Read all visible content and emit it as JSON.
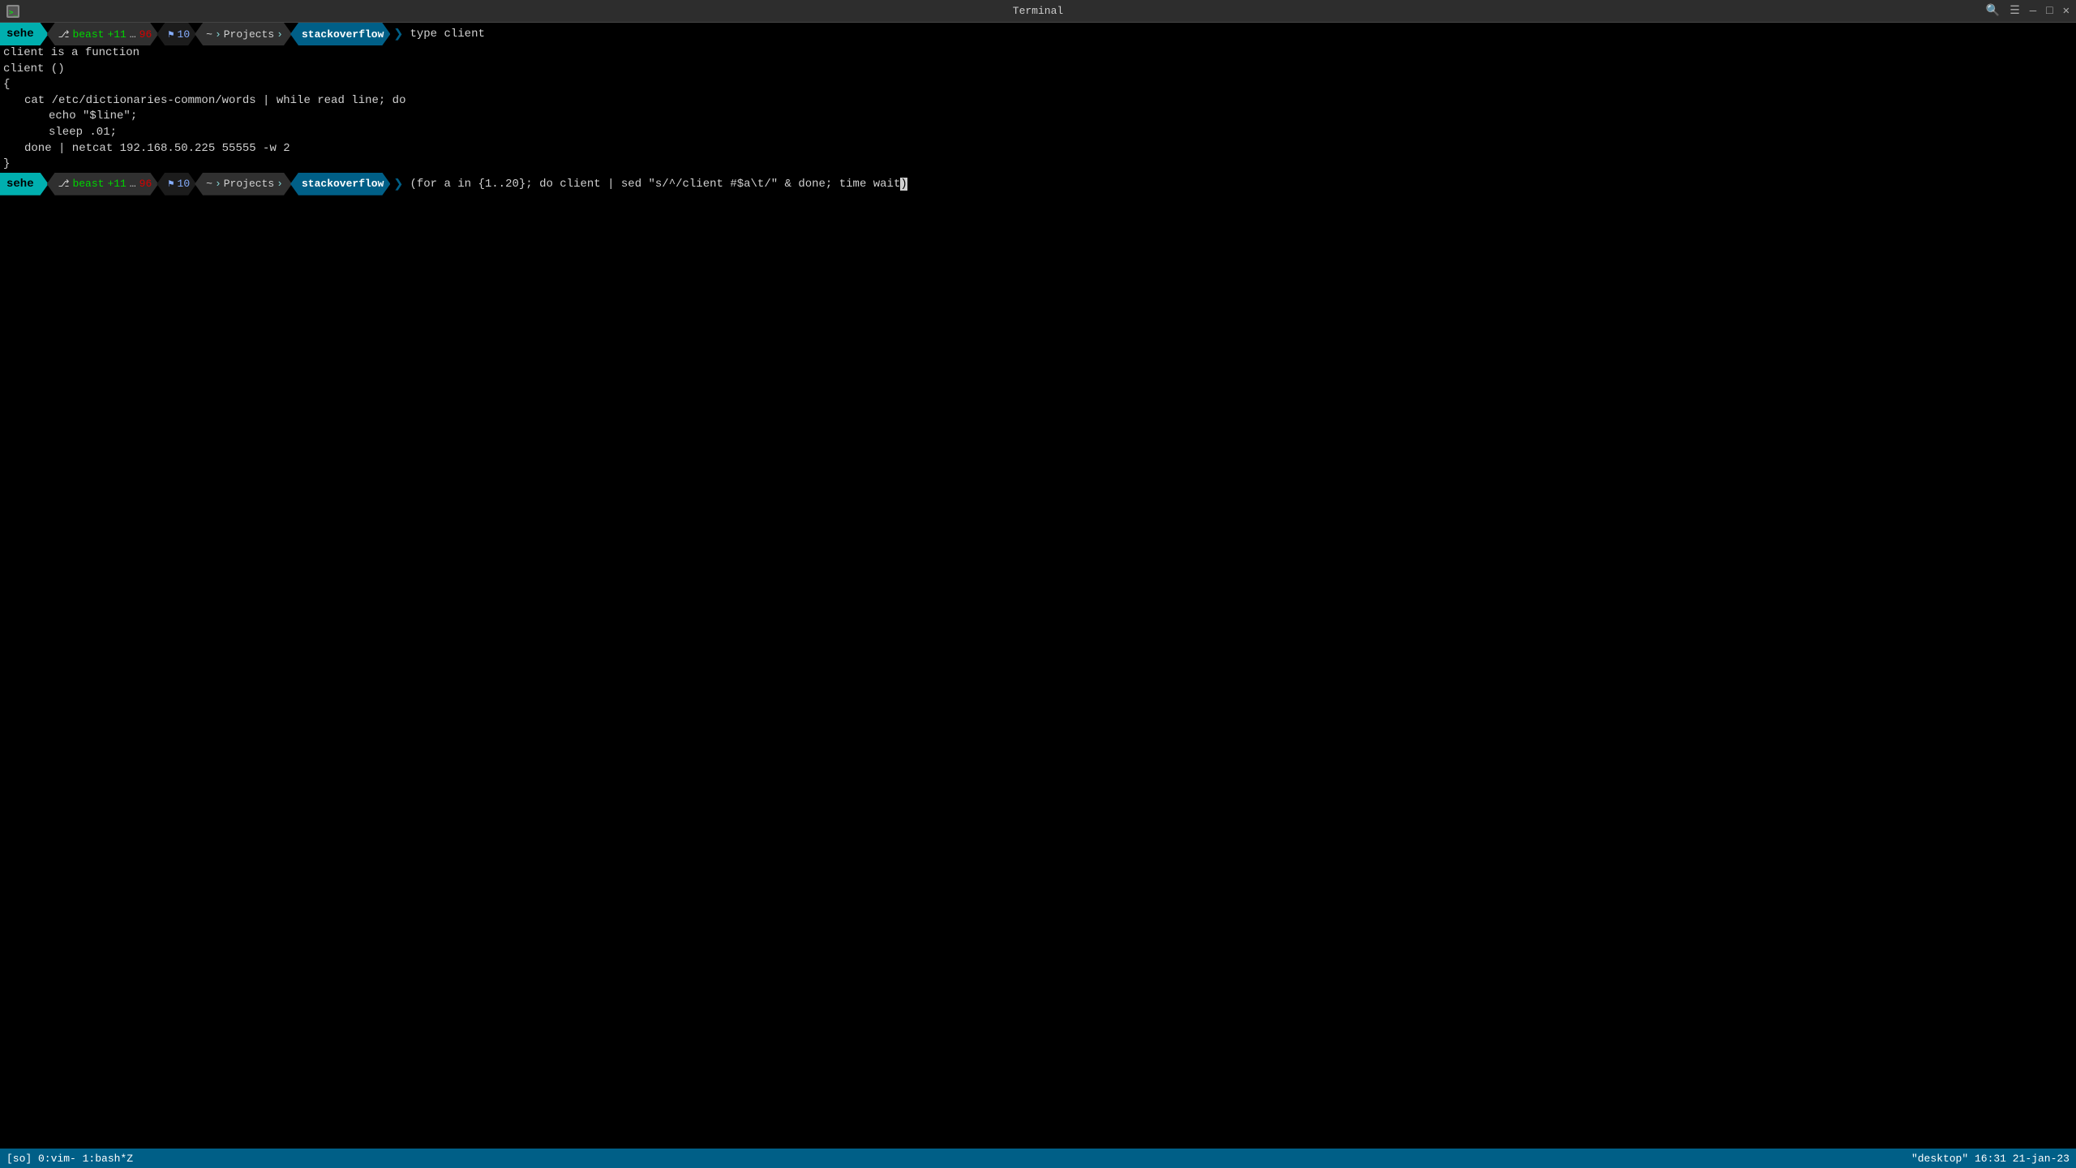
{
  "titlebar": {
    "title": "Terminal",
    "icon": "🖥",
    "buttons": {
      "search": "🔍",
      "menu": "☰",
      "minimize": "—",
      "maximize": "□",
      "close": "✕"
    }
  },
  "terminal": {
    "prompt1": {
      "user": "sehe",
      "git_icon": "⎇",
      "git_branch": "beast",
      "plus_sign": "+11",
      "ellipsis": "…",
      "minus_sign": "96",
      "flag_icon": "⚑",
      "flag_num": "10",
      "home": "~",
      "path": "Projects",
      "dir": "stackoverflow",
      "command": "type client"
    },
    "output": [
      "client is a function",
      "client ()",
      "{",
      "    cat /etc/dictionaries-common/words | while read line; do",
      "        echo \"$line\";",
      "        sleep .01;",
      "    done | netcat 192.168.50.225 55555 -w 2",
      "}"
    ],
    "prompt2": {
      "user": "sehe",
      "git_icon": "⎇",
      "git_branch": "beast",
      "plus_sign": "+11",
      "ellipsis": "…",
      "minus_sign": "96",
      "flag_icon": "⚑",
      "flag_num": "10",
      "home": "~",
      "path": "Projects",
      "dir": "stackoverflow",
      "command": "(for a in {1..20}; do client | sed \"s/^/client #$a\\t/\" & done; time wait)"
    }
  },
  "statusbar": {
    "left": "[so]  0:vim-  1:bash*Z",
    "right": "\"desktop\"  16:31  21-jan-23"
  }
}
